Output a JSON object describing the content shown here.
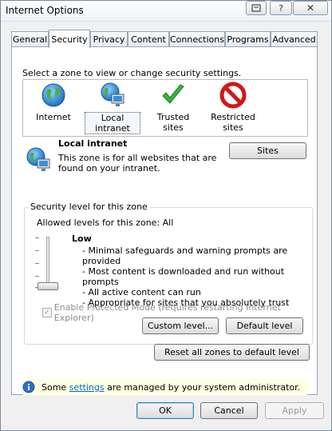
{
  "window": {
    "title": "Internet Options",
    "titlebar_buttons": [
      "help-pin",
      "?",
      "✕"
    ]
  },
  "tabs": [
    {
      "label": "General",
      "active": false
    },
    {
      "label": "Security",
      "active": true
    },
    {
      "label": "Privacy",
      "active": false
    },
    {
      "label": "Content",
      "active": false
    },
    {
      "label": "Connections",
      "active": false
    },
    {
      "label": "Programs",
      "active": false
    },
    {
      "label": "Advanced",
      "active": false
    }
  ],
  "security": {
    "zone_prompt": "Select a zone to view or change security settings.",
    "zones": [
      {
        "label": "Internet",
        "icon": "globe-icon",
        "selected": false
      },
      {
        "label": "Local intranet",
        "icon": "intranet-icon",
        "selected": true
      },
      {
        "label": "Trusted sites",
        "icon": "checkmark-icon",
        "selected": false
      },
      {
        "label": "Restricted sites",
        "icon": "restricted-icon",
        "selected": false
      }
    ],
    "selected_zone": {
      "title": "Local intranet",
      "description": "This zone is for all websites that are found on your intranet."
    },
    "sites_button": "Sites",
    "level_group": {
      "legend": "Security level for this zone",
      "allowed": "Allowed levels for this zone: All",
      "slider_level_fraction": 0,
      "level_name": "Low",
      "level_description": [
        "- Minimal safeguards and warning prompts are provided",
        "- Most content is downloaded and run without prompts",
        "- All active content can run",
        "- Appropriate for sites that you absolutely trust"
      ],
      "protected_mode_label": "Enable Protected Mode (requires restarting Internet Explorer)",
      "protected_mode_checked": true,
      "custom_level_button": "Custom level...",
      "default_level_button": "Default level"
    },
    "reset_all_button": "Reset all zones to default level",
    "info": {
      "prefix": "Some ",
      "link": "settings",
      "suffix": " are managed by your system administrator."
    }
  },
  "footer": {
    "ok": "OK",
    "cancel": "Cancel",
    "apply": "Apply"
  }
}
